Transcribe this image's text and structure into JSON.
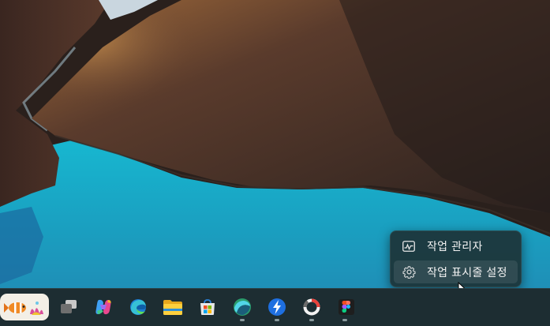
{
  "context_menu": {
    "items": [
      {
        "label": "작업 관리자",
        "icon": "task-manager-icon"
      },
      {
        "label": "작업 표시줄 설정",
        "icon": "gear-icon"
      }
    ]
  },
  "taskbar": {
    "items": [
      {
        "name": "widgets-button",
        "icon": "widgets-fish-icon"
      },
      {
        "name": "task-view-button",
        "icon": "task-view-icon"
      },
      {
        "name": "copilot-button",
        "icon": "copilot-icon"
      },
      {
        "name": "edge-button",
        "icon": "edge-icon"
      },
      {
        "name": "file-explorer-button",
        "icon": "folder-icon"
      },
      {
        "name": "store-button",
        "icon": "store-icon"
      },
      {
        "name": "app-swirl-button",
        "icon": "swirl-icon",
        "running": true
      },
      {
        "name": "app-lightning-button",
        "icon": "lightning-icon",
        "running": true
      },
      {
        "name": "app-ring-button",
        "icon": "ring-icon",
        "running": true
      },
      {
        "name": "figma-button",
        "icon": "figma-icon",
        "running": true
      }
    ]
  },
  "colors": {
    "lake": "#1aa6c4",
    "taskbar": "#1d2d32",
    "menu": "#1c3438"
  }
}
